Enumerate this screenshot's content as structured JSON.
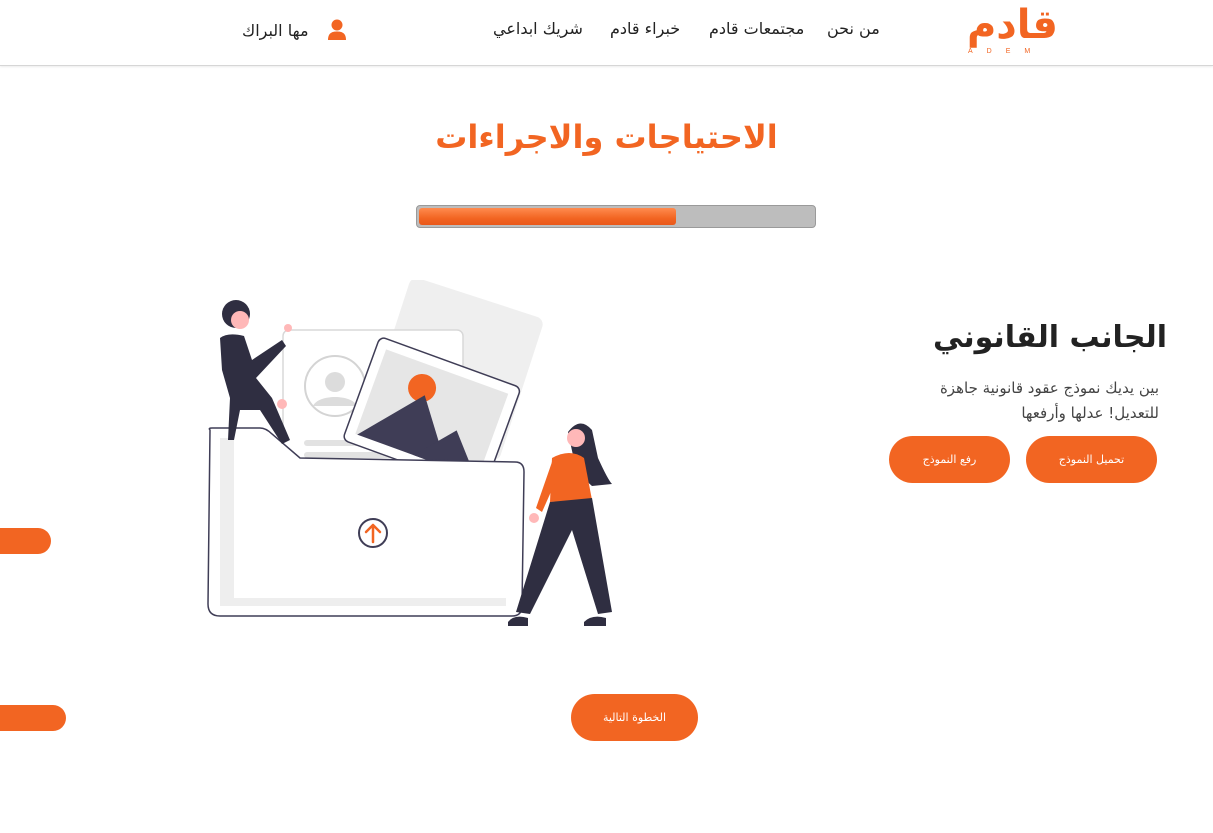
{
  "header": {
    "logo": {
      "arabic": "قادم",
      "latin": "ADEM"
    },
    "nav": [
      {
        "label": "من نحن"
      },
      {
        "label": "مجتمعات قادم"
      },
      {
        "label": "خبراء قادم"
      },
      {
        "label": "شريك ابداعي"
      }
    ],
    "user": {
      "name": "مها البراك",
      "icon": "user-icon"
    }
  },
  "page": {
    "title": "الاحتياجات والاجراءات",
    "progress_percent": 65
  },
  "section": {
    "title": "الجانب القانوني",
    "description_line1": "بين يديك نموذج عقود قانونية جاهزة",
    "description_line2": "للتعديل! عدلها وأرفعها",
    "download_label": "تحميل النموذج",
    "upload_label": "رفع النموذج",
    "next_label": "الخطوة التالية"
  },
  "colors": {
    "accent": "#f26522",
    "dark": "#2f2e41",
    "text": "#222222"
  }
}
